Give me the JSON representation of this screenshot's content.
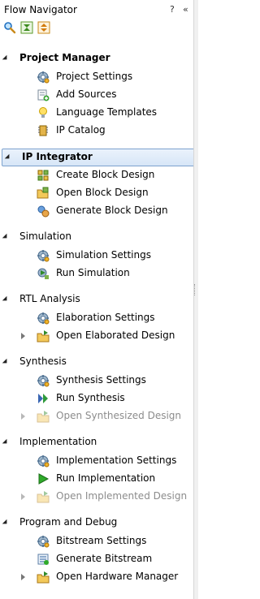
{
  "panel": {
    "title": "Flow Navigator",
    "help": "?",
    "collapse": "«"
  },
  "toolbar": {
    "icons": [
      "search-icon",
      "collapse-all-icon",
      "expand-all-icon"
    ]
  },
  "sections": [
    {
      "title": "Project Manager",
      "bold": true,
      "selected": false,
      "items": [
        {
          "label": "Project Settings",
          "icon": "gear-icon",
          "expandable": false,
          "disabled": false
        },
        {
          "label": "Add Sources",
          "icon": "add-sources-icon",
          "expandable": false,
          "disabled": false
        },
        {
          "label": "Language Templates",
          "icon": "lightbulb-icon",
          "expandable": false,
          "disabled": false
        },
        {
          "label": "IP Catalog",
          "icon": "ip-chip-icon",
          "expandable": false,
          "disabled": false
        }
      ]
    },
    {
      "title": "IP Integrator",
      "bold": true,
      "selected": true,
      "items": [
        {
          "label": "Create Block Design",
          "icon": "create-block-icon",
          "expandable": false,
          "disabled": false
        },
        {
          "label": "Open Block Design",
          "icon": "open-block-icon",
          "expandable": false,
          "disabled": false
        },
        {
          "label": "Generate Block Design",
          "icon": "generate-block-icon",
          "expandable": false,
          "disabled": false
        }
      ]
    },
    {
      "title": "Simulation",
      "bold": false,
      "selected": false,
      "items": [
        {
          "label": "Simulation Settings",
          "icon": "gear-icon",
          "expandable": false,
          "disabled": false
        },
        {
          "label": "Run Simulation",
          "icon": "run-simulation-icon",
          "expandable": false,
          "disabled": false
        }
      ]
    },
    {
      "title": "RTL Analysis",
      "bold": false,
      "selected": false,
      "items": [
        {
          "label": "Elaboration Settings",
          "icon": "gear-icon",
          "expandable": false,
          "disabled": false
        },
        {
          "label": "Open Elaborated Design",
          "icon": "open-design-icon",
          "expandable": true,
          "disabled": false
        }
      ]
    },
    {
      "title": "Synthesis",
      "bold": false,
      "selected": false,
      "items": [
        {
          "label": "Synthesis Settings",
          "icon": "gear-icon",
          "expandable": false,
          "disabled": false
        },
        {
          "label": "Run Synthesis",
          "icon": "run-synthesis-icon",
          "expandable": false,
          "disabled": false
        },
        {
          "label": "Open Synthesized Design",
          "icon": "open-design-icon",
          "expandable": true,
          "disabled": true
        }
      ]
    },
    {
      "title": "Implementation",
      "bold": false,
      "selected": false,
      "items": [
        {
          "label": "Implementation Settings",
          "icon": "gear-icon",
          "expandable": false,
          "disabled": false
        },
        {
          "label": "Run Implementation",
          "icon": "play-icon",
          "expandable": false,
          "disabled": false
        },
        {
          "label": "Open Implemented Design",
          "icon": "open-design-icon",
          "expandable": true,
          "disabled": true
        }
      ]
    },
    {
      "title": "Program and Debug",
      "bold": false,
      "selected": false,
      "items": [
        {
          "label": "Bitstream Settings",
          "icon": "gear-icon",
          "expandable": false,
          "disabled": false
        },
        {
          "label": "Generate Bitstream",
          "icon": "bitstream-icon",
          "expandable": false,
          "disabled": false
        },
        {
          "label": "Open Hardware Manager",
          "icon": "open-design-icon",
          "expandable": true,
          "disabled": false
        }
      ]
    }
  ]
}
